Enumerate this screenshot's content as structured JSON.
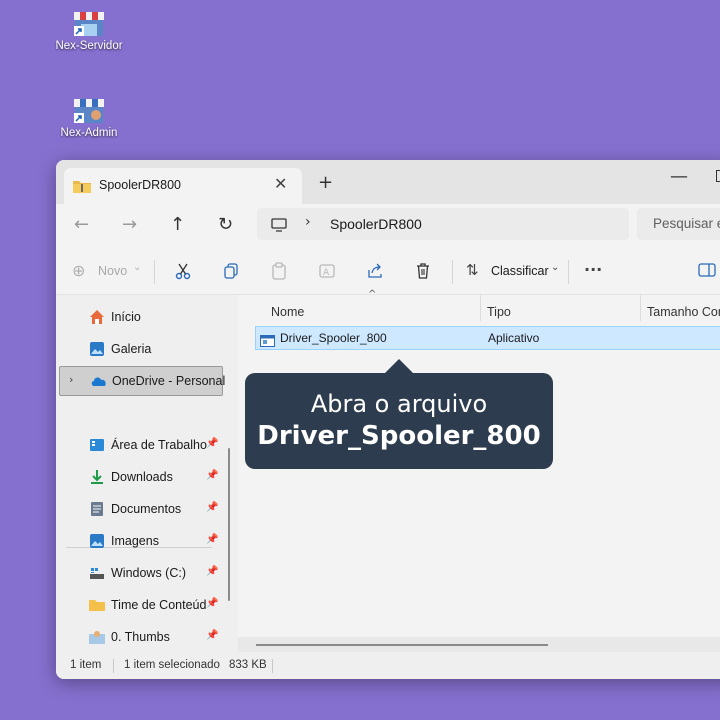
{
  "desktop": {
    "icons": [
      {
        "label": "Nex-Servidor"
      },
      {
        "label": "Nex-Admin"
      }
    ]
  },
  "window": {
    "tab_title": "SpoolerDR800",
    "address": {
      "path": "SpoolerDR800"
    },
    "search_placeholder": "Pesquisar e",
    "toolbar": {
      "new_label": "Novo",
      "sort_label": "Classificar",
      "more_label": "···"
    },
    "sidebar": {
      "items": [
        {
          "label": "Início"
        },
        {
          "label": "Galeria"
        },
        {
          "label": "OneDrive - Personal"
        },
        {
          "label": "Área de Trabalho"
        },
        {
          "label": "Downloads"
        },
        {
          "label": "Documentos"
        },
        {
          "label": "Imagens"
        },
        {
          "label": "Windows (C:)"
        },
        {
          "label": "Time de Conteúd"
        },
        {
          "label": "0. Thumbs"
        }
      ]
    },
    "columns": {
      "name": "Nome",
      "type": "Tipo",
      "size": "Tamanho Con"
    },
    "files": [
      {
        "name": "Driver_Spooler_800",
        "type": "Aplicativo"
      }
    ],
    "status": {
      "count": "1 item",
      "selected": "1 item selecionado",
      "size": "833 KB"
    }
  },
  "tooltip": {
    "line1": "Abra o arquivo",
    "line2": "Driver_Spooler_800"
  },
  "colors": {
    "desktop_bg": "#8670cf",
    "selection": "#cde8ff",
    "tooltip_bg": "#2d3c4e"
  }
}
